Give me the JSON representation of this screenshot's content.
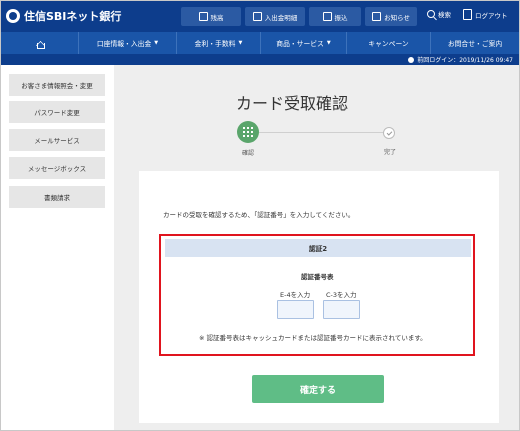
{
  "header": {
    "logo_text": "住信SBIネット銀行",
    "buttons": [
      {
        "label": "残高",
        "icon": "phone-icon"
      },
      {
        "label": "入出金明細",
        "icon": "statement-icon"
      },
      {
        "label": "振込",
        "icon": "transfer-icon"
      },
      {
        "label": "お知らせ",
        "icon": "mail-icon"
      }
    ],
    "search_label": "検索",
    "logout_label": "ログアウト"
  },
  "nav": {
    "items": [
      {
        "label": "口座情報・入出金",
        "has_menu": true
      },
      {
        "label": "金利・手数料",
        "has_menu": true
      },
      {
        "label": "商品・サービス",
        "has_menu": true
      },
      {
        "label": "キャンペーン",
        "has_menu": false
      },
      {
        "label": "お問合せ・ご案内",
        "has_menu": false
      }
    ]
  },
  "status": {
    "last_login": "前回ログイン：2019/11/26 09:47"
  },
  "sidebar": {
    "items": [
      {
        "label": "お客さま情報照会・変更"
      },
      {
        "label": "パスワード変更"
      },
      {
        "label": "メールサービス"
      },
      {
        "label": "メッセージボックス"
      },
      {
        "label": "書類請求"
      }
    ]
  },
  "page": {
    "title": "カード受取確認",
    "steps": [
      {
        "label": "確認",
        "state": "active"
      },
      {
        "label": "完了",
        "state": "pending"
      }
    ],
    "intro": "カードの受取を確認するため、「認証番号」を入力してください。"
  },
  "auth": {
    "heading": "認証2",
    "subheading": "認証番号表",
    "fields": [
      {
        "label": "E-4を入力",
        "value": ""
      },
      {
        "label": "C-3を入力",
        "value": ""
      }
    ],
    "note": "※ 認証番号表はキャッシュカードまたは認証番号カードに表示されています。"
  },
  "actions": {
    "confirm_label": "確定する"
  },
  "colors": {
    "header_bg": "#0d3d8c",
    "nav_bg": "#1a55a8",
    "step_active": "#5aa56b",
    "confirm_button": "#5fbd86",
    "highlight_border": "#e0141e"
  }
}
